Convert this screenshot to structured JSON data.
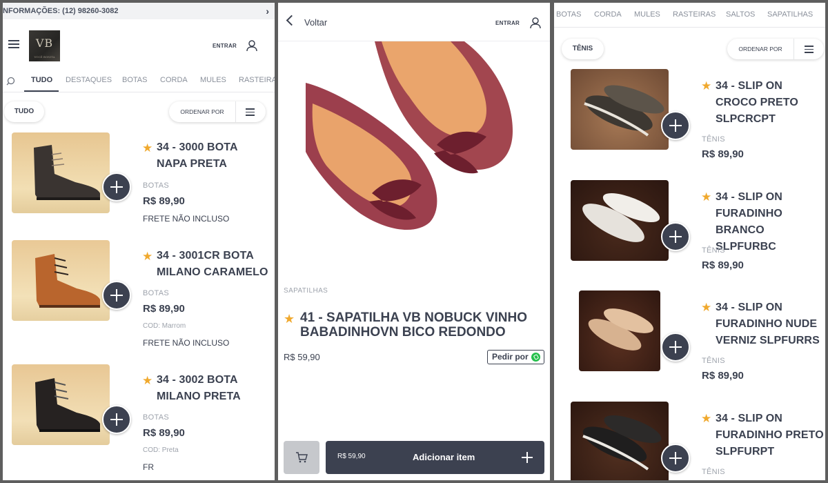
{
  "panel1": {
    "info_text": "NFORMAÇÕES: (12) 98260-3082",
    "logo_text": "VB",
    "logo_subtext": "VOCÊ BONITA",
    "login_label": "ENTRAR",
    "tabs": [
      "TUDO",
      "DESTAQUES",
      "BOTAS",
      "CORDA",
      "MULES",
      "RASTEIRA"
    ],
    "filter_chip": "TUDO",
    "sort_label": "ORDENAR POR",
    "products": [
      {
        "name_line1": "34 - 3000 BOTA",
        "name_line2": "NAPA PRETA",
        "category": "BOTAS",
        "price": "R$ 89,90",
        "cod": "",
        "note": "FRETE NÃO INCLUSO"
      },
      {
        "name_line1": "34 - 3001CR BOTA",
        "name_line2": "MILANO CARAMELO",
        "category": "BOTAS",
        "price": "R$ 89,90",
        "cod": "COD: Marrom",
        "note": "FRETE NÃO INCLUSO"
      },
      {
        "name_line1": "34 - 3002 BOTA",
        "name_line2": "MILANO PRETA",
        "category": "BOTAS",
        "price": "R$ 89,90",
        "cod": "COD: Preta",
        "note": "FR"
      }
    ]
  },
  "panel2": {
    "back_label": "Voltar",
    "login_label": "ENTRAR",
    "category": "SAPATILHAS",
    "title_line1": "41 - SAPATILHA VB NOBUCK VINHO",
    "title_line2": "BABADINHOVN BICO REDONDO",
    "price": "R$ 59,90",
    "order_label": "Pedir por",
    "add_price": "R$ 59,90",
    "add_label": "Adicionar item"
  },
  "panel3": {
    "tabs": [
      "BOTAS",
      "CORDA",
      "MULES",
      "RASTEIRAS",
      "SALTOS",
      "SAPATILHAS"
    ],
    "filter_chip": "TÊNIS",
    "sort_label": "ORDENAR POR",
    "products": [
      {
        "line1": "34 - SLIP ON",
        "line2": "CROCO PRETO",
        "line3": "SLPCRCPT",
        "category": "TÊNIS",
        "price": "R$ 89,90"
      },
      {
        "line1": "34 - SLIP ON",
        "line2": "FURADINHO",
        "line3": "BRANCO SLPFURBC",
        "category": "TÊNIS",
        "price": "R$ 89,90"
      },
      {
        "line1": "34 - SLIP ON",
        "line2": "FURADINHO NUDE",
        "line3": "VERNIZ SLPFURRS",
        "category": "TÊNIS",
        "price": "R$ 89,90"
      },
      {
        "line1": "34 - SLIP ON",
        "line2": "FURADINHO PRETO",
        "line3": "SLPFURPT",
        "category": "TÊNIS",
        "price": ""
      }
    ]
  },
  "colors": {
    "accent": "#3c4150",
    "star": "#f0a92e",
    "whatsapp": "#25c04c",
    "muted": "#9ea3ac"
  }
}
